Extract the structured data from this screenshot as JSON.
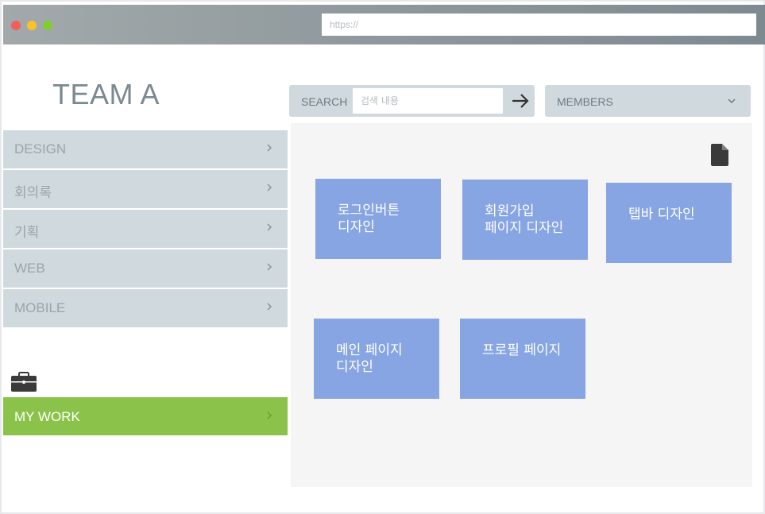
{
  "browser": {
    "url_placeholder": "https://"
  },
  "team": {
    "title": "TEAM A"
  },
  "sidebar": {
    "items": [
      {
        "label": "DESIGN"
      },
      {
        "label": "회의록"
      },
      {
        "label": "기획"
      },
      {
        "label": "WEB"
      },
      {
        "label": "MOBILE"
      }
    ],
    "mywork_label": "MY WORK"
  },
  "search": {
    "label": "SEARCH",
    "placeholder": "검색 내용"
  },
  "members": {
    "label": "MEMBERS"
  },
  "cards": [
    {
      "title": "로그인버튼 디자인"
    },
    {
      "title": "회원가입 페이지 디자인"
    },
    {
      "title": "탭바 디자인"
    },
    {
      "title": "메인 페이지 디자인"
    },
    {
      "title": "프로필 페이지"
    }
  ],
  "colors": {
    "accent_green": "#8bc34a",
    "card_blue": "#87a5e3",
    "sidebar_gray": "#d0d9de"
  },
  "icons": {
    "chevron": "chevron-right-icon",
    "briefcase": "briefcase-icon",
    "arrow": "arrow-right-icon",
    "caret": "chevron-down-icon",
    "file": "file-icon"
  }
}
